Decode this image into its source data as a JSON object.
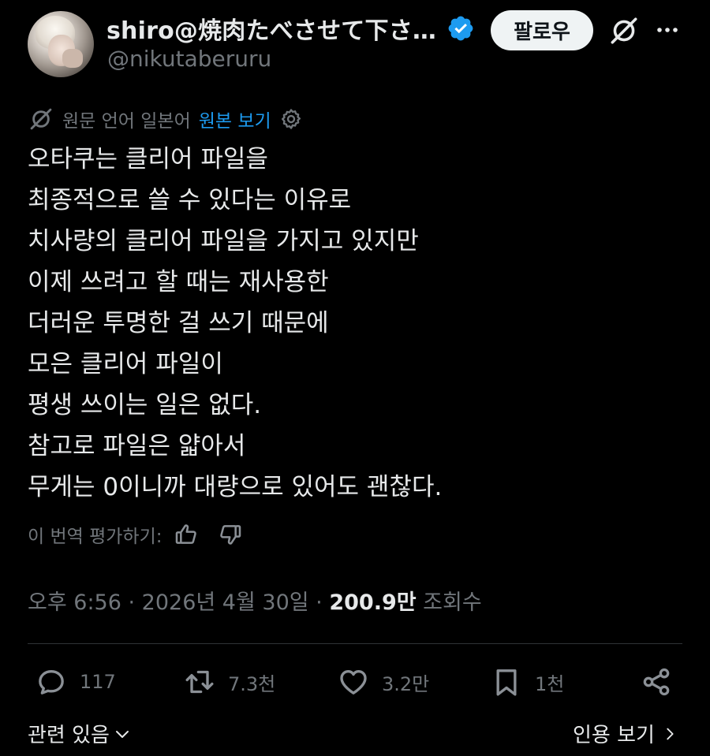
{
  "author": {
    "display_name": "shiro@焼肉たべさせて下さ…",
    "handle": "@nikutaberuru",
    "follow_label": "팔로우"
  },
  "translation": {
    "source_language": "원문 언어 일본어",
    "show_original_label": "원본 보기"
  },
  "tweet": {
    "lines": [
      "오타쿠는 클리어 파일을",
      "최종적으로 쓸 수 있다는 이유로",
      "치사량의 클리어 파일을 가지고 있지만",
      "이제 쓰려고 할 때는 재사용한",
      "더러운 투명한 걸 쓰기 때문에",
      "모은 클리어 파일이",
      "평생 쓰이는 일은 없다.",
      "참고로 파일은 얇아서",
      "무게는 0이니까 대량으로 있어도 괜찮다."
    ]
  },
  "rate": {
    "label": "이 번역 평가하기:"
  },
  "meta": {
    "time": "오후 6:56",
    "separator": " · ",
    "date": "2026년 4월 30일",
    "views_count": "200.9만",
    "views_label": " 조회수"
  },
  "actions": {
    "replies": "117",
    "reposts": "7.3천",
    "likes": "3.2만",
    "bookmarks": "1천"
  },
  "footer": {
    "related_label": "관련 있음",
    "quotes_label": "인용 보기"
  },
  "colors": {
    "background": "#000000",
    "text": "#e7e9ea",
    "secondary": "#71767b",
    "link": "#1d9bf0",
    "verified": "#1d9bf0"
  }
}
